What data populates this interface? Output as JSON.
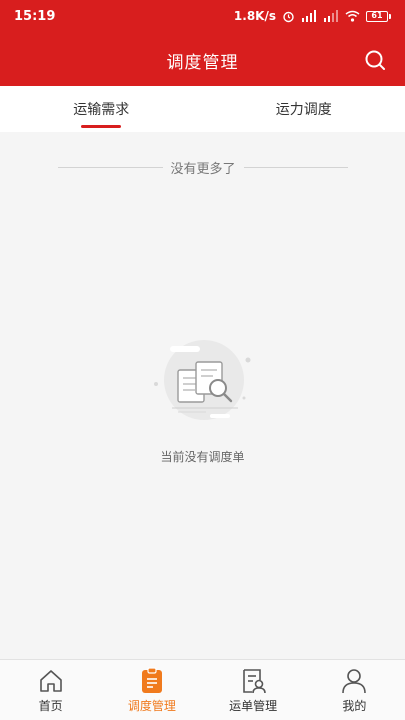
{
  "status_bar": {
    "time": "15:19",
    "network_speed": "1.8K/s",
    "battery": "61"
  },
  "header": {
    "title": "调度管理",
    "search_icon": "search-icon"
  },
  "tabs": [
    {
      "label": "运输需求",
      "active": true
    },
    {
      "label": "运力调度",
      "active": false
    }
  ],
  "list": {
    "end_text": "没有更多了"
  },
  "empty_state": {
    "message": "当前没有调度单",
    "icon": "empty-documents-icon"
  },
  "bottom_nav": [
    {
      "label": "首页",
      "icon": "home-icon",
      "active": false
    },
    {
      "label": "调度管理",
      "icon": "clipboard-icon",
      "active": true
    },
    {
      "label": "运单管理",
      "icon": "waybill-icon",
      "active": false
    },
    {
      "label": "我的",
      "icon": "user-icon",
      "active": false
    }
  ],
  "colors": {
    "brand_red": "#d81e1e",
    "active_orange": "#f07a1d"
  }
}
